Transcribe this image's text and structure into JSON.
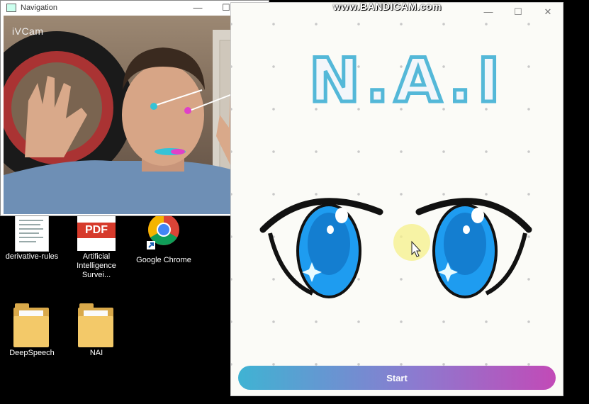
{
  "camera_window": {
    "title": "Navigation",
    "watermark": "iVCam",
    "controls": {
      "minimize": "—",
      "maximize": "☐",
      "close": "✕"
    }
  },
  "desktop": {
    "icons": [
      {
        "label": "derivative-rules",
        "kind": "document"
      },
      {
        "label": "Artificial Intelligence Survei...",
        "kind": "pdf",
        "thumb_text": "PDF"
      },
      {
        "label": "Google Chrome",
        "kind": "chrome-shortcut"
      },
      {
        "label": "DeepSpeech",
        "kind": "folder"
      },
      {
        "label": "NAI",
        "kind": "folder"
      }
    ]
  },
  "recorder_watermark": "www.BANDICAM.com",
  "nai_app": {
    "logo": "N.A.I",
    "controls": {
      "minimize": "—",
      "maximize": "☐",
      "close": "✕"
    },
    "start_label": "Start",
    "colors": {
      "start_from": "#3fb3d3",
      "start_to": "#c24ab7",
      "eye": "#1e9cf0"
    }
  }
}
